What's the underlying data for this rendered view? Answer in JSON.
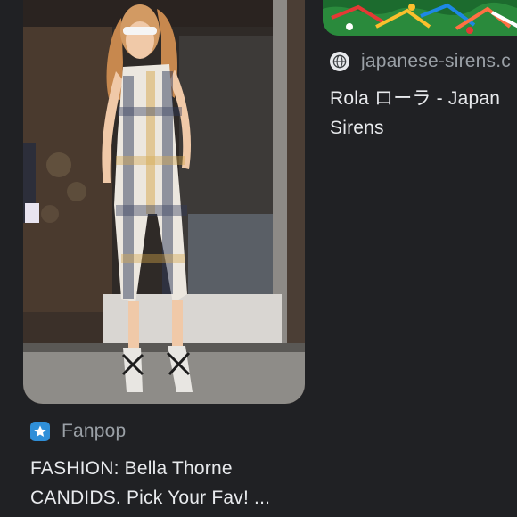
{
  "results": [
    {
      "source": "Fanpop",
      "favicon": "fanpop-star-icon",
      "title_line1": "FASHION: Bella Thorne",
      "title_line2": "CANDIDS. Pick Your Fav! ..."
    },
    {
      "source": "japanese-sirens.c",
      "favicon": "globe-icon",
      "title_line1": "Rola ローラ - Japan",
      "title_line2": "Sirens"
    }
  ],
  "colors": {
    "background": "#202124",
    "title_text": "#e8eaed",
    "source_text": "#9aa0a6",
    "fanpop_brand": "#2f8fd8"
  }
}
